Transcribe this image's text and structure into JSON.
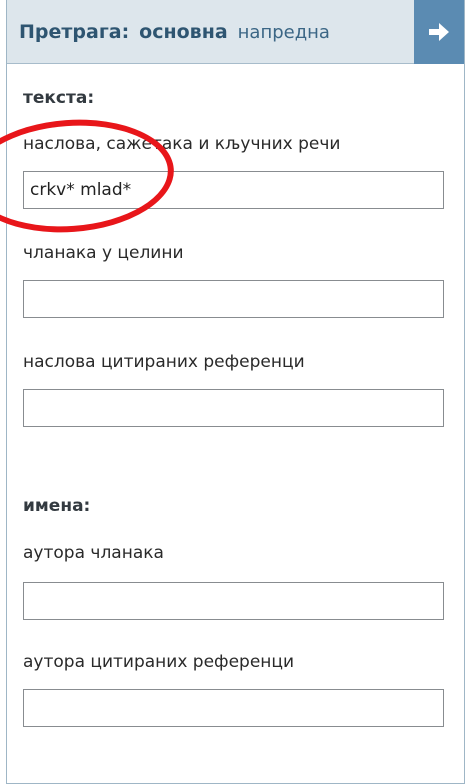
{
  "header": {
    "title": "Претрага:",
    "mode_basic": "основна",
    "mode_advanced": "напредна",
    "go_icon": "arrow-right-icon"
  },
  "text_section": {
    "heading": "текста:",
    "fields": [
      {
        "label": "наслова, сажетака и кључних речи",
        "value": "crkv* mlad*",
        "placeholder": ""
      },
      {
        "label": "чланака у целини",
        "value": "",
        "placeholder": ""
      },
      {
        "label": "наслова цитираних референци",
        "value": "",
        "placeholder": ""
      }
    ]
  },
  "names_section": {
    "heading": "имена:",
    "fields": [
      {
        "label": "аутора чланака",
        "value": "",
        "placeholder": ""
      },
      {
        "label": "аутора цитираних референци",
        "value": "",
        "placeholder": ""
      }
    ]
  },
  "annotation": {
    "color": "#e8161a"
  },
  "colors": {
    "header_bg": "#dde6ec",
    "accent": "#5b8bb2",
    "header_text": "#2e5571"
  }
}
